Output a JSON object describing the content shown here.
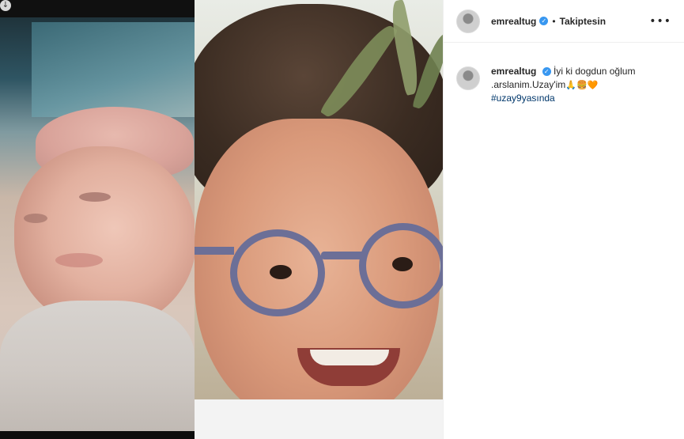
{
  "post": {
    "username": "emrealtug",
    "verified_badge": "✓",
    "separator": "•",
    "follow_status": "Takiptesin",
    "more_options": "•••",
    "caption": {
      "username": "emrealtug",
      "line1": "İyi ki dogdun oğlum",
      "line2": ".arslanim.Uzay'im",
      "emojis": "🙏🍔🧡",
      "hashtag": "#uzay9yasında"
    }
  },
  "media": {
    "download_icon": "↓"
  },
  "colors": {
    "verified": "#3897f0",
    "hashtag": "#00376b",
    "text": "#262626"
  }
}
